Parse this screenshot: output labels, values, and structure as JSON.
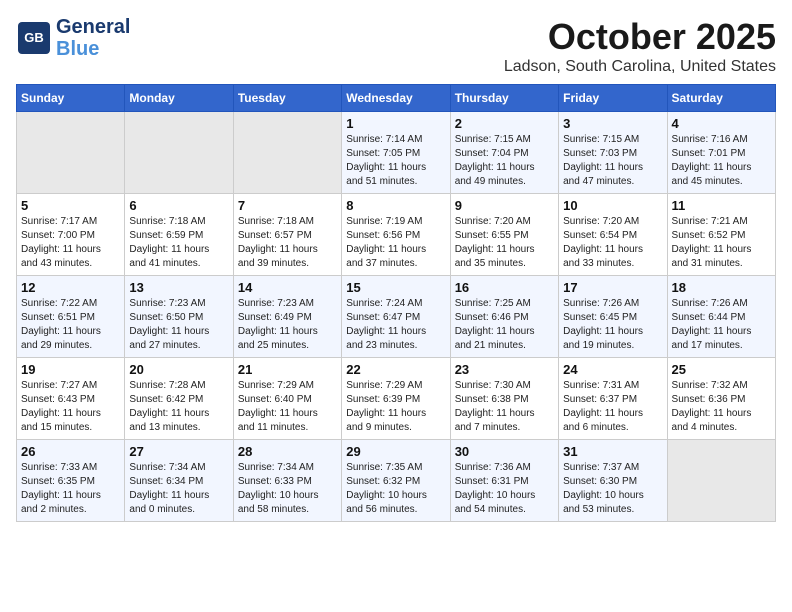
{
  "logo": {
    "line1": "General",
    "line2": "Blue",
    "tagline": ""
  },
  "title": "October 2025",
  "subtitle": "Ladson, South Carolina, United States",
  "weekdays": [
    "Sunday",
    "Monday",
    "Tuesday",
    "Wednesday",
    "Thursday",
    "Friday",
    "Saturday"
  ],
  "weeks": [
    [
      {
        "day": "",
        "info": ""
      },
      {
        "day": "",
        "info": ""
      },
      {
        "day": "",
        "info": ""
      },
      {
        "day": "1",
        "info": "Sunrise: 7:14 AM\nSunset: 7:05 PM\nDaylight: 11 hours\nand 51 minutes."
      },
      {
        "day": "2",
        "info": "Sunrise: 7:15 AM\nSunset: 7:04 PM\nDaylight: 11 hours\nand 49 minutes."
      },
      {
        "day": "3",
        "info": "Sunrise: 7:15 AM\nSunset: 7:03 PM\nDaylight: 11 hours\nand 47 minutes."
      },
      {
        "day": "4",
        "info": "Sunrise: 7:16 AM\nSunset: 7:01 PM\nDaylight: 11 hours\nand 45 minutes."
      }
    ],
    [
      {
        "day": "5",
        "info": "Sunrise: 7:17 AM\nSunset: 7:00 PM\nDaylight: 11 hours\nand 43 minutes."
      },
      {
        "day": "6",
        "info": "Sunrise: 7:18 AM\nSunset: 6:59 PM\nDaylight: 11 hours\nand 41 minutes."
      },
      {
        "day": "7",
        "info": "Sunrise: 7:18 AM\nSunset: 6:57 PM\nDaylight: 11 hours\nand 39 minutes."
      },
      {
        "day": "8",
        "info": "Sunrise: 7:19 AM\nSunset: 6:56 PM\nDaylight: 11 hours\nand 37 minutes."
      },
      {
        "day": "9",
        "info": "Sunrise: 7:20 AM\nSunset: 6:55 PM\nDaylight: 11 hours\nand 35 minutes."
      },
      {
        "day": "10",
        "info": "Sunrise: 7:20 AM\nSunset: 6:54 PM\nDaylight: 11 hours\nand 33 minutes."
      },
      {
        "day": "11",
        "info": "Sunrise: 7:21 AM\nSunset: 6:52 PM\nDaylight: 11 hours\nand 31 minutes."
      }
    ],
    [
      {
        "day": "12",
        "info": "Sunrise: 7:22 AM\nSunset: 6:51 PM\nDaylight: 11 hours\nand 29 minutes."
      },
      {
        "day": "13",
        "info": "Sunrise: 7:23 AM\nSunset: 6:50 PM\nDaylight: 11 hours\nand 27 minutes."
      },
      {
        "day": "14",
        "info": "Sunrise: 7:23 AM\nSunset: 6:49 PM\nDaylight: 11 hours\nand 25 minutes."
      },
      {
        "day": "15",
        "info": "Sunrise: 7:24 AM\nSunset: 6:47 PM\nDaylight: 11 hours\nand 23 minutes."
      },
      {
        "day": "16",
        "info": "Sunrise: 7:25 AM\nSunset: 6:46 PM\nDaylight: 11 hours\nand 21 minutes."
      },
      {
        "day": "17",
        "info": "Sunrise: 7:26 AM\nSunset: 6:45 PM\nDaylight: 11 hours\nand 19 minutes."
      },
      {
        "day": "18",
        "info": "Sunrise: 7:26 AM\nSunset: 6:44 PM\nDaylight: 11 hours\nand 17 minutes."
      }
    ],
    [
      {
        "day": "19",
        "info": "Sunrise: 7:27 AM\nSunset: 6:43 PM\nDaylight: 11 hours\nand 15 minutes."
      },
      {
        "day": "20",
        "info": "Sunrise: 7:28 AM\nSunset: 6:42 PM\nDaylight: 11 hours\nand 13 minutes."
      },
      {
        "day": "21",
        "info": "Sunrise: 7:29 AM\nSunset: 6:40 PM\nDaylight: 11 hours\nand 11 minutes."
      },
      {
        "day": "22",
        "info": "Sunrise: 7:29 AM\nSunset: 6:39 PM\nDaylight: 11 hours\nand 9 minutes."
      },
      {
        "day": "23",
        "info": "Sunrise: 7:30 AM\nSunset: 6:38 PM\nDaylight: 11 hours\nand 7 minutes."
      },
      {
        "day": "24",
        "info": "Sunrise: 7:31 AM\nSunset: 6:37 PM\nDaylight: 11 hours\nand 6 minutes."
      },
      {
        "day": "25",
        "info": "Sunrise: 7:32 AM\nSunset: 6:36 PM\nDaylight: 11 hours\nand 4 minutes."
      }
    ],
    [
      {
        "day": "26",
        "info": "Sunrise: 7:33 AM\nSunset: 6:35 PM\nDaylight: 11 hours\nand 2 minutes."
      },
      {
        "day": "27",
        "info": "Sunrise: 7:34 AM\nSunset: 6:34 PM\nDaylight: 11 hours\nand 0 minutes."
      },
      {
        "day": "28",
        "info": "Sunrise: 7:34 AM\nSunset: 6:33 PM\nDaylight: 10 hours\nand 58 minutes."
      },
      {
        "day": "29",
        "info": "Sunrise: 7:35 AM\nSunset: 6:32 PM\nDaylight: 10 hours\nand 56 minutes."
      },
      {
        "day": "30",
        "info": "Sunrise: 7:36 AM\nSunset: 6:31 PM\nDaylight: 10 hours\nand 54 minutes."
      },
      {
        "day": "31",
        "info": "Sunrise: 7:37 AM\nSunset: 6:30 PM\nDaylight: 10 hours\nand 53 minutes."
      },
      {
        "day": "",
        "info": ""
      }
    ]
  ]
}
